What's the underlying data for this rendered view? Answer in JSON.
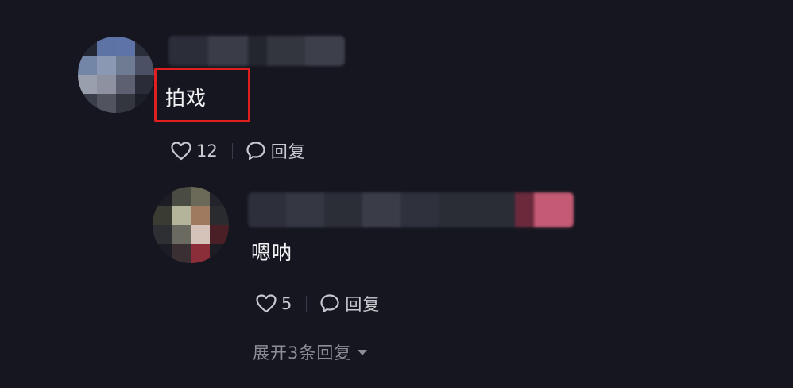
{
  "comments": [
    {
      "text": "拍戏",
      "likes": "12",
      "reply_label": "回复"
    }
  ],
  "replies": [
    {
      "text": "嗯呐",
      "likes": "5",
      "reply_label": "回复"
    }
  ],
  "expand_label": "展开3条回复",
  "colors": {
    "background": "#15161f",
    "highlight": "#e02020",
    "muted_text": "#8c8d97"
  },
  "icons": {
    "like": "heart-outline-icon",
    "reply": "speech-bubble-icon",
    "expand": "caret-down-icon"
  }
}
